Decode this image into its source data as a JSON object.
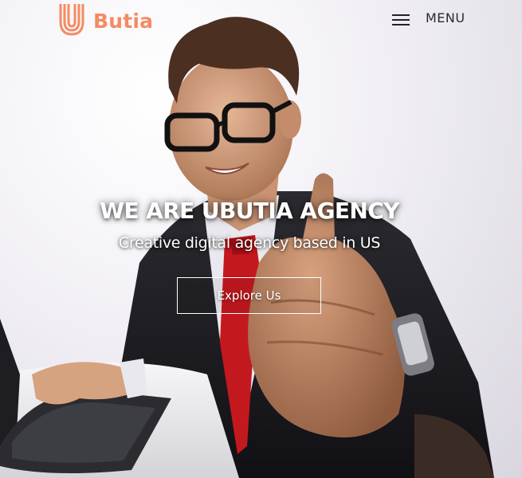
{
  "brand": {
    "name": "Butia",
    "icon": "u-logo-icon",
    "color": "#f48b63"
  },
  "nav": {
    "menu_label": "MENU",
    "menu_icon": "hamburger-icon"
  },
  "hero": {
    "headline": "WE ARE UBUTIA AGENCY",
    "tagline": "Creative digital agency based in US",
    "cta_label": "Explore Us",
    "image": "businessman-thumbs-up-photo"
  }
}
